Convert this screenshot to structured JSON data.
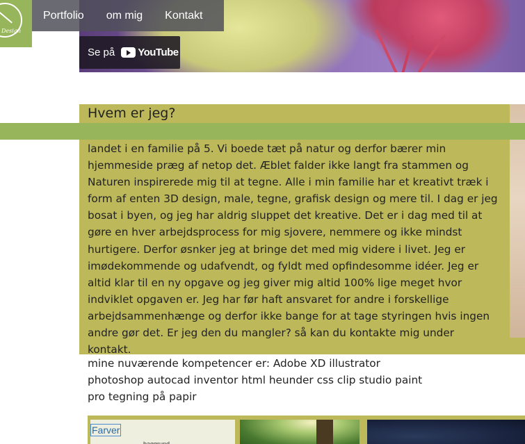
{
  "nav": {
    "items": [
      {
        "label": "Portfolio"
      },
      {
        "label": "om mig"
      },
      {
        "label": "Kontakt"
      }
    ]
  },
  "video": {
    "watch_label": "Se på",
    "platform_label": "YouTube"
  },
  "about": {
    "heading": "Hvem er jeg?",
    "body": "landet i en familie på 5. Vi boede tæt på natur og derfor bærer min hjemmeside præg af netop det. Æblet falder ikke langt fra stammen og Naturen inspirerede mig til at tegne. Alle i min familie har et kreativt træk i form af enten 3D design, male, tegne, grafisk design og mere til. I dag er jeg bosat i byen, og jeg har aldrig sluppet det kreative. Det er i dag med til at gøre en hver arbejdsprocess for mig sjovere, nemmere og ikke mindst hurtigere. Derfor øsnker jeg at bringe det med mig videre i livet. Jeg er imødekommende og udafvendt, og fyldt med opfindesomme idéer. Jeg er altid klar til en ny opgave og jeg giver mig altid 100% lige meget hvor indviklet opgaven er. Jeg har før haft ansvaret for andre i forskellige arbejdsammenhænge og derfor ikke bange for at tage styringen hvis ingen andre gør det. Er jeg den du mangler? så kan du kontakte mig under kontakt."
  },
  "skills": {
    "text": "mine nuværende kompetencer er: Adobe XD illustrator photoshop autocad inventor html heunder css clip studio paint pro tegning på papir"
  },
  "gallery": {
    "thumb1_title": "Farver",
    "thumb1_caption": "baggrund"
  },
  "colors": {
    "brand_green": "#97b55a",
    "about_olive": "#bdb85a",
    "nav_bg": "#50505a"
  }
}
